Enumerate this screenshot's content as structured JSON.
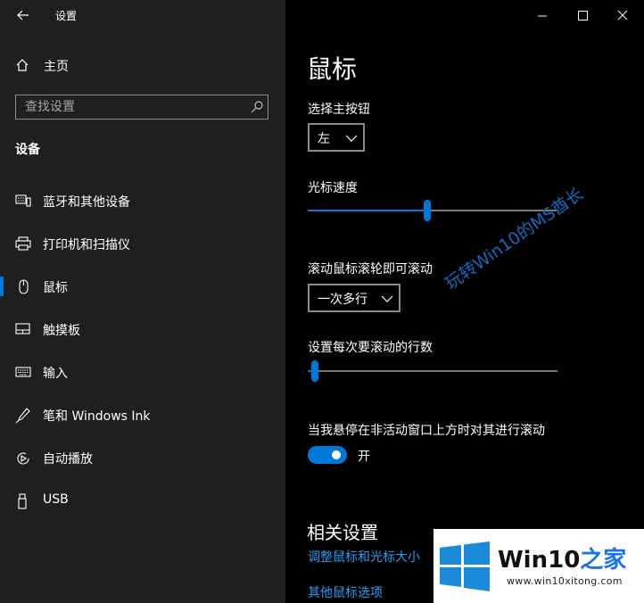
{
  "window": {
    "title": "设置"
  },
  "sidebar": {
    "home_label": "主页",
    "search_placeholder": "查找设置",
    "section_title": "设备",
    "items": [
      {
        "label": "蓝牙和其他设备",
        "icon": "bluetooth-devices-icon"
      },
      {
        "label": "打印机和扫描仪",
        "icon": "printer-icon"
      },
      {
        "label": "鼠标",
        "icon": "mouse-icon",
        "active": true
      },
      {
        "label": "触摸板",
        "icon": "touchpad-icon"
      },
      {
        "label": "输入",
        "icon": "keyboard-icon"
      },
      {
        "label": "笔和 Windows Ink",
        "icon": "pen-icon"
      },
      {
        "label": "自动播放",
        "icon": "autoplay-icon"
      },
      {
        "label": "USB",
        "icon": "usb-icon"
      }
    ]
  },
  "main": {
    "title": "鼠标",
    "primary_button": {
      "label": "选择主按钮",
      "value": "左"
    },
    "cursor_speed": {
      "label": "光标速度",
      "value_fraction": 0.48
    },
    "scroll_mode": {
      "label": "滚动鼠标滚轮即可滚动",
      "value": "一次多行"
    },
    "lines_per_scroll": {
      "label": "设置每次要滚动的行数",
      "value_fraction": 0.03
    },
    "inactive_scroll": {
      "label": "当我悬停在非活动窗口上方时对其进行滚动",
      "state": "开",
      "on": true
    },
    "related": {
      "title": "相关设置",
      "links": [
        "调整鼠标和光标大小",
        "其他鼠标选项"
      ]
    }
  },
  "watermark": "玩转Win10的MS酋长",
  "logo": {
    "brand_part1": "Win10",
    "brand_part2": "之家",
    "url": "www.win10xitong.com"
  },
  "colors": {
    "accent": "#0078d7",
    "link": "#2b9bf4",
    "sidebar_bg": "#1f1f1f",
    "main_bg": "#000000"
  }
}
